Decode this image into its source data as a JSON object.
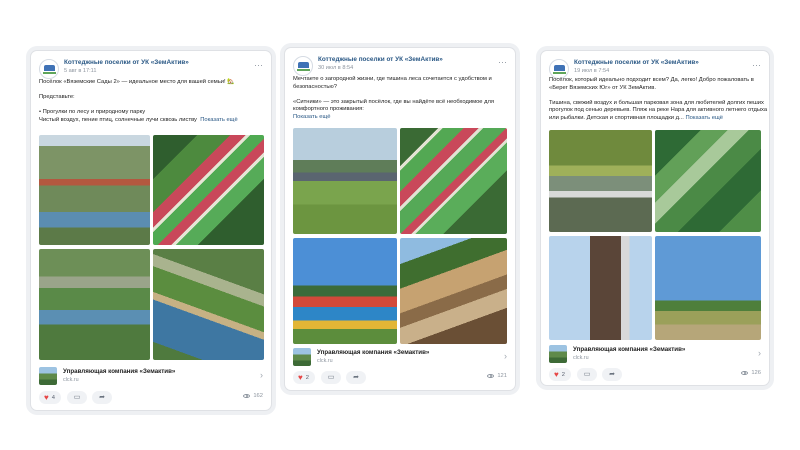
{
  "posts": [
    {
      "group": "Коттеджные поселки от УК «ЗемАктив»",
      "date": "5 авг в 17:11",
      "text": [
        "Посёлок «Вяземские Сады 2» — идеальное место для вашей семьи! 🏡",
        "",
        "Представьте:",
        "",
        "• Прогулки по лесу и природному парку",
        "Чистый воздух, пение птиц, солнечные лучи сквозь листву"
      ],
      "show_more": "Показать ещё",
      "attachment": {
        "title": "Управляющая компания «Земактив»",
        "url": "clck.ru"
      },
      "likes": "4",
      "views": "162"
    },
    {
      "group": "Коттеджные поселки от УК «ЗемАктив»",
      "date": "30 июл в 8:54",
      "text": [
        "Мечтаете о загородной жизни, где тишина леса сочетается с удобством и",
        "безопасностью?",
        "",
        "«Ситники» — это закрытый посёлок, где вы найдёте всё необходимое для",
        "комфортного проживания:"
      ],
      "show_more": "Показать ещё",
      "attachment": {
        "title": "Управляющая компания «Земактив»",
        "url": "clck.ru"
      },
      "likes": "2",
      "views": "121"
    },
    {
      "group": "Коттеджные поселки от УК «ЗемАктив»",
      "date": "19 июл в 7:54",
      "text": [
        "Посёлок, который идеально подходит всем? Да, легко! Добро пожаловать в",
        "«Берег Вяземских Юг» от УК ЗемАктив.",
        "",
        "Тишина, свежий воздух и большая парковая зона для любителей долгих пеших",
        "прогулок под сенью деревьев. Пляж на реке Нара для активного летнего отдыха",
        "или рыбалки. Детская и спортивная площадки д..."
      ],
      "show_more": "Показать ещё",
      "attachment": {
        "title": "Управляющая компания «Земактив»",
        "url": "clck.ru"
      },
      "likes": "2",
      "views": "126"
    }
  ],
  "colors": {
    "link": "#2a5885",
    "heart": "#e64646",
    "muted": "#8c949e"
  },
  "icons": {
    "more": "more-dots-icon",
    "like": "heart-icon",
    "comment": "comment-icon",
    "share": "share-icon",
    "views": "eye-icon",
    "chevron": "chevron-right-icon"
  }
}
